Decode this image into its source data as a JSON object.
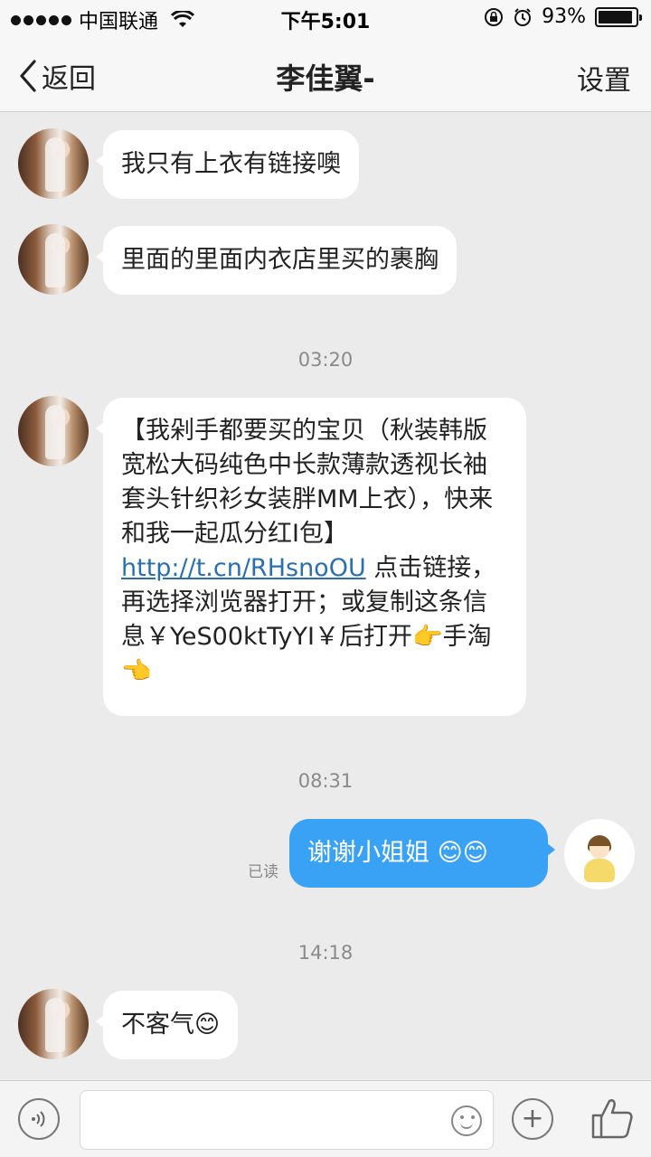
{
  "status_bar": {
    "carrier": "中国联通",
    "time": "下午5:01",
    "battery_percent": "93%",
    "battery_level": 0.93
  },
  "nav": {
    "back_label": "返回",
    "title": "李佳翼-",
    "settings_label": "设置"
  },
  "messages": [
    {
      "sender": "other",
      "text": "我只有上衣有链接噢"
    },
    {
      "sender": "other",
      "text": "里面的里面内衣店里买的裹胸"
    },
    {
      "timestamp": "03:20"
    },
    {
      "sender": "other",
      "pre_link": "【我剁手都要买的宝贝（秋装韩版宽松大码纯色中长款薄款透视长袖套头针织衫女装胖MM上衣），快来和我一起瓜分红I包】",
      "link": "http://t.cn/RHsnoOU",
      "post_link": " 点击链接，再选择浏览器打开；或复制这条信息￥YeS00ktTyYI￥后打开👉手淘👈"
    },
    {
      "timestamp": "08:31"
    },
    {
      "sender": "me",
      "text": "谢谢小姐姐 😊😊",
      "read_label": "已读"
    },
    {
      "timestamp": "14:18"
    },
    {
      "sender": "other",
      "text": "不客气😊"
    }
  ],
  "input_bar": {
    "voice_icon": "voice-icon",
    "emoji_icon": "emoji-icon",
    "plus_icon": "plus-icon",
    "like_icon": "thumbs-up-icon"
  }
}
